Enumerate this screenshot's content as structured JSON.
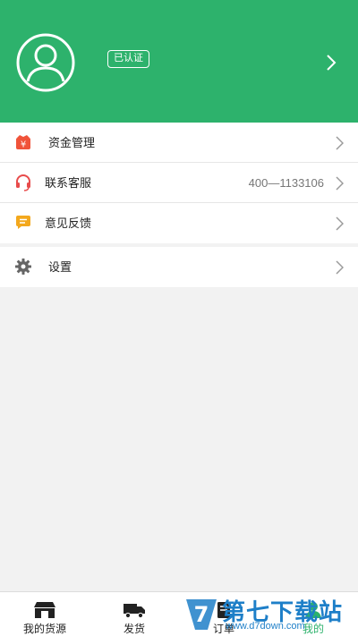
{
  "header": {
    "badge": "已认证",
    "avatar_icon": "user-avatar-icon",
    "chevron_icon": "chevron-right-icon",
    "background_color": "#2db26c"
  },
  "menu": {
    "funds": {
      "label": "资金管理",
      "icon": "wallet-icon",
      "icon_glyph": "¥"
    },
    "service": {
      "label": "联系客服",
      "value": "400—1133106",
      "icon": "headset-icon"
    },
    "feedback": {
      "label": "意见反馈",
      "icon": "message-icon"
    },
    "settings": {
      "label": "设置",
      "icon": "gear-icon"
    }
  },
  "tabs": [
    {
      "label": "我的货源",
      "icon": "store-icon",
      "active": false
    },
    {
      "label": "发货",
      "icon": "truck-icon",
      "active": false
    },
    {
      "label": "订单",
      "icon": "order-icon",
      "active": false
    },
    {
      "label": "我的",
      "icon": "profile-icon",
      "active": true
    }
  ],
  "watermark": {
    "title": "第七下载站",
    "url": "www.d7down.com",
    "mark": "7"
  },
  "colors": {
    "accent": "#2db26c",
    "watermark": "#1e7fc8"
  }
}
